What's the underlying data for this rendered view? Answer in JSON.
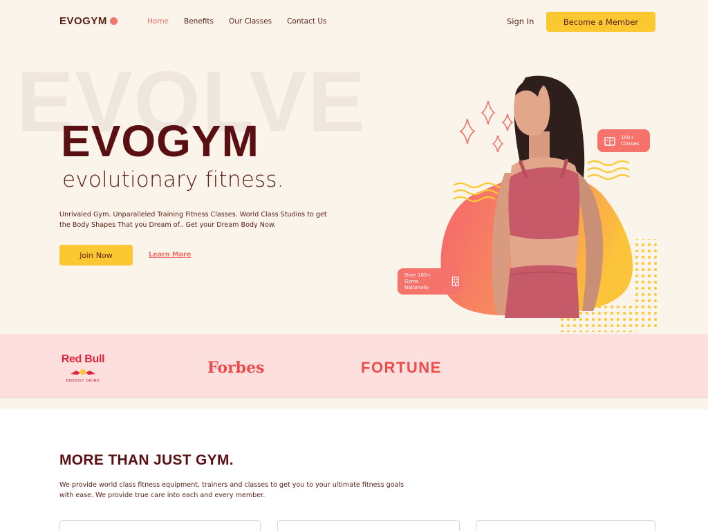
{
  "nav": {
    "logo_text": "EVOGYM",
    "links": [
      "Home",
      "Benefits",
      "Our Classes",
      "Contact Us"
    ],
    "sign_in": "Sign In",
    "cta": "Become a Member"
  },
  "hero": {
    "bg_word": "EVOLVE",
    "title": "EVOGYM",
    "subtitle": "evolutionary fitness.",
    "description": "Unrivaled Gym. Unparalleled Training Fitness Classes. World Class Studios to get the Body Shapes That you Dream of.. Get your Dream Body Now.",
    "join_button": "Join Now",
    "learn_link": "Learn More",
    "badge_classes": "100+ Classes",
    "badge_gyms": "Over 100+ Gyms Nationally"
  },
  "sponsors": {
    "redbull": "Red Bull",
    "redbull_sub": "ENERGY DRINK",
    "forbes": "Forbes",
    "fortune": "FORTUNE"
  },
  "benefits": {
    "title": "MORE THAN JUST GYM.",
    "description": "We provide world class fitness equipment, trainers and classes to get you to your ultimate fitness goals with ease. We provide true care into each and every member."
  },
  "colors": {
    "background": "#faf4ea",
    "primary_dark": "#5a0f12",
    "accent_coral": "#f6736b",
    "accent_yellow": "#fcc832",
    "sponsor_band": "#fde0dd"
  }
}
